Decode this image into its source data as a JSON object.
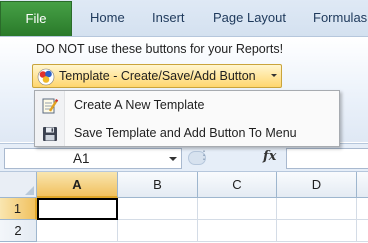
{
  "tabs": {
    "file": "File",
    "items": [
      "Home",
      "Insert",
      "Page Layout",
      "Formulas"
    ]
  },
  "ribbon": {
    "notice": "DO NOT use these buttons for your Reports!",
    "template_button": "Template - Create/Save/Add Button"
  },
  "menu": {
    "items": [
      {
        "label": "Create A New Template",
        "icon": "notepad-pencil-icon"
      },
      {
        "label": "Save Template and Add Button To Menu",
        "icon": "floppy-disk-icon"
      }
    ]
  },
  "formula_bar": {
    "name_box": "A1",
    "fx": "fx",
    "formula": ""
  },
  "sheet": {
    "columns": [
      "A",
      "B",
      "C",
      "D"
    ],
    "rows": [
      "1",
      "2"
    ],
    "active_cell": "A1"
  },
  "colors": {
    "file_tab": "#2f8a2f",
    "ribbon": "#dfe9f5",
    "accent_gold": "#f1c15f"
  }
}
